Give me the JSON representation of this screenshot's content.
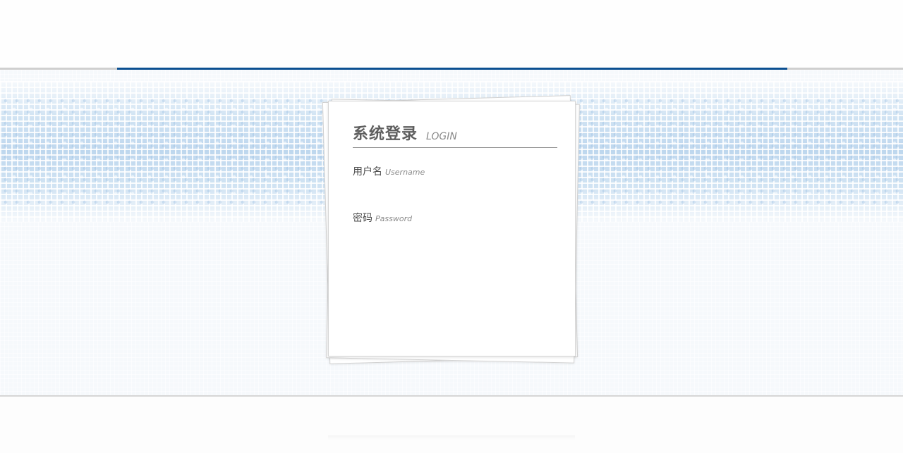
{
  "colors": {
    "accent_line": "#0b4f91",
    "divider_gray": "#cfcfcf",
    "title_text": "#5e5e5e",
    "label_text": "#4a4a4a",
    "hint_text": "#8a8a8a"
  },
  "login_card": {
    "title": "系统登录",
    "subtitle": "LOGIN",
    "username": {
      "label": "用户名",
      "hint": "Username",
      "value": "",
      "placeholder": ""
    },
    "password": {
      "label": "密码",
      "hint": "Password",
      "value": "",
      "placeholder": ""
    }
  }
}
